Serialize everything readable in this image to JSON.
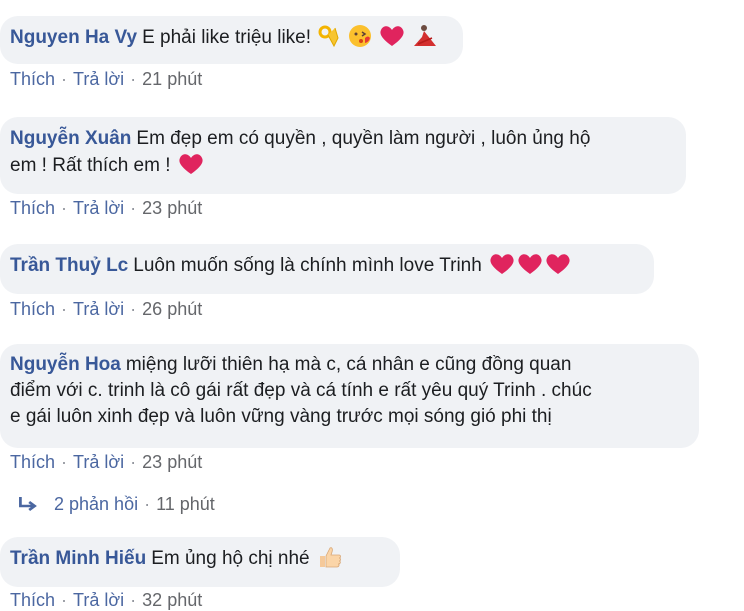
{
  "comments": [
    {
      "author": "Nguyen Ha Vy",
      "text": "E phải like triệu like!",
      "emoji": [
        "ok-hand",
        "kiss-face",
        "red-heart",
        "dancer"
      ],
      "like_label": "Thích",
      "reply_label": "Trả lời",
      "time": "21 phút"
    },
    {
      "author": "Nguyễn Xuân",
      "text": "Em đẹp em có quyền , quyền làm người , luôn ủng hộ",
      "text2": "em ! Rất thích em !",
      "emoji": [
        "red-heart"
      ],
      "like_label": "Thích",
      "reply_label": "Trả lời",
      "time": "23 phút"
    },
    {
      "author": "Trần Thuỷ Lc",
      "text": "Luôn muốn sống là chính mình love Trinh",
      "emoji": [
        "red-heart",
        "red-heart",
        "red-heart"
      ],
      "like_label": "Thích",
      "reply_label": "Trả lời",
      "time": "26 phút"
    },
    {
      "author": "Nguyễn Hoa",
      "text": "miệng lưỡi thiên hạ mà c, cá nhân e cũng đồng quan",
      "text2": "điểm với c. trinh là cô gái rất đẹp và cá tính e rất yêu quý Trinh . chúc",
      "text3": "e gái luôn xinh đẹp và luôn vững vàng trước mọi sóng gió phi thị",
      "like_label": "Thích",
      "reply_label": "Trả lời",
      "time": "23 phút"
    },
    {
      "author": "Trần Minh Hiếu",
      "text": "Em ủng hộ chị nhé",
      "emoji": [
        "thumbs-up"
      ],
      "like_label": "Thích",
      "reply_label": "Trả lời",
      "time": "32 phút"
    }
  ],
  "replies": {
    "count_label": "2 phản hồi",
    "time": "11 phút",
    "icon": "reply-arrow-icon"
  },
  "colors": {
    "bubble": "#f0f2f5",
    "author": "#385898",
    "link": "#4b67a1",
    "meta": "#65676b",
    "heart": "#e0245e"
  }
}
